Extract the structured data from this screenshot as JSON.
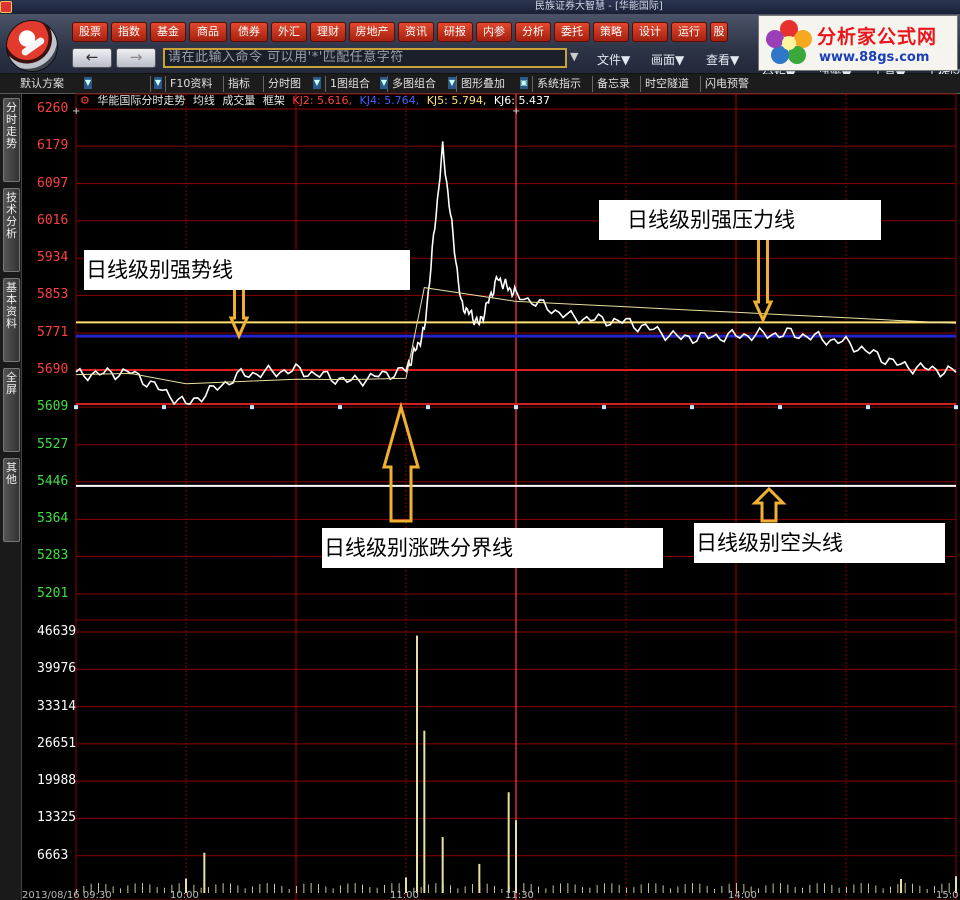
{
  "app": {
    "title": "民族证券大智慧 - [华能国际]",
    "brand_name": "分析家公式网",
    "brand_url": "www.88gs.com"
  },
  "menu": [
    "股票",
    "指数",
    "基金",
    "商品",
    "债券",
    "外汇",
    "理财",
    "房地产",
    "资讯",
    "研报",
    "内参",
    "分析",
    "委托",
    "策略",
    "设计",
    "运行",
    "股"
  ],
  "command": {
    "placeholder": "请在此输入命令      可以用'*'匹配任意字符"
  },
  "tool_menus": [
    "文件▼",
    "画面▼",
    "查看▼",
    "分析▼",
    "决策▼",
    "工具▼",
    "工作区"
  ],
  "function_bar": {
    "scheme": "默认方案",
    "items": [
      "F10资料",
      "指标",
      "分时图",
      "1图组合",
      "多图组合",
      "图形叠加",
      "系统指示",
      "备忘录",
      "时空隧道",
      "闪电预警"
    ]
  },
  "left_tabs": [
    "分时走势",
    "技术分析",
    "基本资料",
    "全屏",
    "其他"
  ],
  "chart_header": {
    "stock": "华能国际分时走势",
    "avg": "均线",
    "vol": "成交量",
    "frame": "框架",
    "kj2": "KJ2: 5.616,",
    "kj4": "KJ4: 5.764,",
    "kj5": "KJ5: 5.794,",
    "kj6": "KJ6: 5.437"
  },
  "colors": {
    "up_red": "#ff4040",
    "down_green": "#40e040",
    "grid_red": "#8a0000",
    "price_line": "#ffffff",
    "avg_line": "#e8e0a0",
    "resistance_yellow": "#ffe070",
    "strong_blue": "#2020c0",
    "arrow_orange": "#f0b030"
  },
  "annotations": {
    "strong": "日线级别强势线",
    "pressure": "日线级别强压力线",
    "divide": "日线级别涨跌分界线",
    "bear": "日线级别空头线"
  },
  "time_axis": {
    "date_start": "2013/08/16 09:30",
    "ticks": [
      "10:00",
      "11:00",
      "11:30",
      "14:00",
      "15:0"
    ]
  },
  "chart_data": [
    {
      "type": "line",
      "title": "华能国际分时走势",
      "y_unit": "price (labels ×1000)",
      "ylim": [
        5201,
        6260
      ],
      "y_ticks_up": [
        6260,
        6179,
        6097,
        6016,
        5934,
        5853,
        5771,
        5690
      ],
      "y_ticks_down": [
        5609,
        5527,
        5446,
        5364,
        5283,
        5201
      ],
      "reference_price": 5609,
      "x": [
        "09:30",
        "09:45",
        "10:00",
        "10:15",
        "10:30",
        "10:45",
        "11:00",
        "11:05",
        "11:10",
        "11:15",
        "11:20",
        "11:25",
        "11:30",
        "13:15",
        "13:30",
        "13:45",
        "14:00",
        "14:15",
        "14:30",
        "14:45",
        "15:00"
      ],
      "series": [
        {
          "values": [
            5680,
            5685,
            5615,
            5680,
            5690,
            5665,
            5690,
            5775,
            6175,
            5835,
            5790,
            5890,
            5855,
            5805,
            5795,
            5760,
            5765,
            5770,
            5750,
            5700,
            5685
          ]
        }
      ],
      "horizontal_lines": [
        {
          "label": "KJ5",
          "value": 5794
        },
        {
          "label": "KJ4",
          "value": 5764
        },
        {
          "label": "KJ2",
          "value": 5616
        },
        {
          "label": "KJ6",
          "value": 5437
        }
      ]
    },
    {
      "type": "bar",
      "title": "成交量",
      "ylim": [
        0,
        46639
      ],
      "y_ticks": [
        46639,
        39976,
        33314,
        26651,
        19988,
        13325,
        6663
      ],
      "x": [
        "10:00",
        "11:00",
        "11:03",
        "11:05",
        "11:10",
        "11:20",
        "11:28",
        "11:30",
        "11:35",
        "14:45",
        "15:00"
      ],
      "values": [
        2600,
        2800,
        46000,
        29000,
        10000,
        5200,
        18000,
        13000,
        7200,
        2500,
        3000
      ]
    }
  ]
}
